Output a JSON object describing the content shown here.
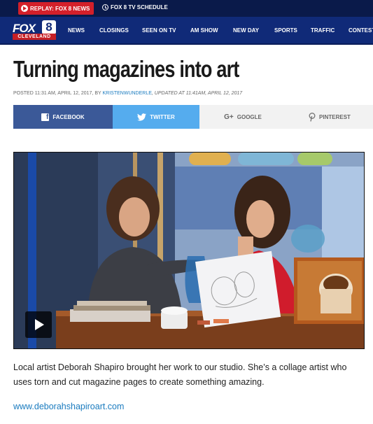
{
  "topbar": {
    "replay_label": "REPLAY: FOX 8 NEWS",
    "schedule_label": "FOX 8 TV SCHEDULE"
  },
  "logo": {
    "brand": "FOX",
    "channel": "8",
    "city": "CLEVELAND"
  },
  "nav": {
    "items": [
      "NEWS",
      "CLOSINGS",
      "SEEN ON TV",
      "AM SHOW",
      "NEW DAY",
      "SPORTS",
      "TRAFFIC",
      "CONTESTS"
    ]
  },
  "article": {
    "title": "Turning magazines into art",
    "byline_prefix": "POSTED 11:31 AM, APRIL 12, 2017, BY ",
    "author": "KRISTENWUNDERLE",
    "updated": ", UPDATED AT 11:41AM, APRIL 12, 2017",
    "paragraph": "Local artist Deborah Shapiro brought her work to our studio. She’s a collage artist who uses torn and cut magazine pages to create something amazing.",
    "link_text": "www.deborahshapiroart.com"
  },
  "share": {
    "facebook": "FACEBOOK",
    "twitter": "TWITTER",
    "google": "GOOGLE",
    "pinterest": "PINTEREST"
  },
  "icons": {
    "replay": "play-circle-icon",
    "schedule": "clock-icon",
    "facebook": "facebook-icon",
    "twitter": "twitter-bird-icon",
    "google": "google-plus-icon",
    "pinterest": "pinterest-icon",
    "video": "play-icon"
  },
  "colors": {
    "topbar": "#0a1a4a",
    "nav": "#102a78",
    "replay": "#d3202a",
    "facebook": "#3b5998",
    "twitter": "#55acee",
    "link": "#1a7bbf"
  }
}
